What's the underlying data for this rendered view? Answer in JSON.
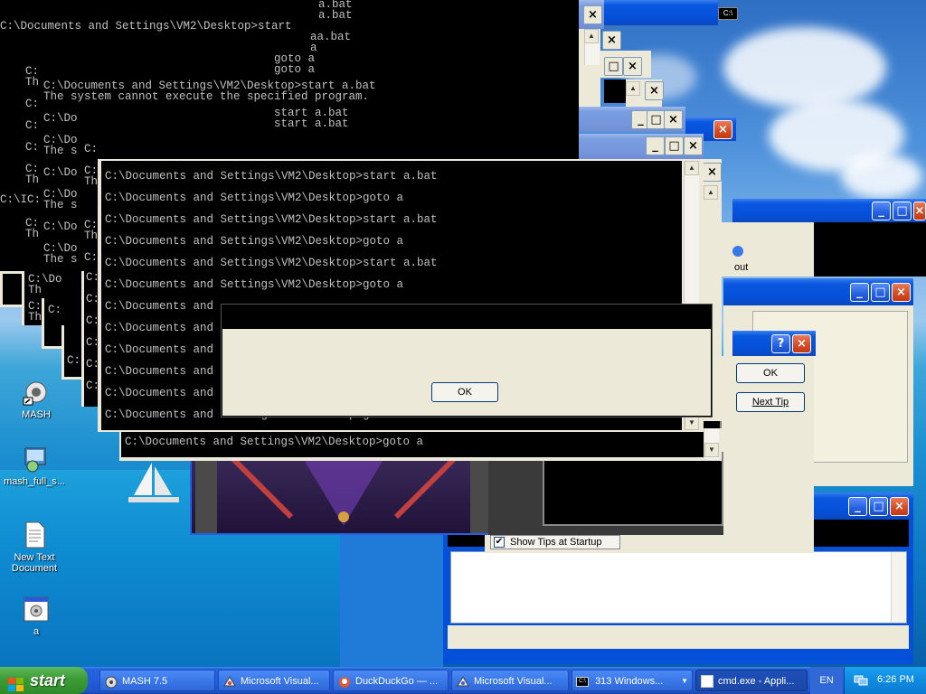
{
  "console_main": {
    "top_lines": [
      "a.bat",
      "a.bat"
    ],
    "line1": "C:\\Documents and Settings\\VM2\\Desktop>start",
    "col_lines": [
      "aa.bat",
      "a",
      "goto a",
      "goto a"
    ],
    "stack_lines": [
      "start a.bat",
      "start a.bat"
    ],
    "c_prompt": "C:",
    "cmd_start": "C:\\Documents and Settings\\VM2\\Desktop>start a.bat",
    "error": "The system cannot execute the specified program.",
    "frag_th": "Th",
    "frag_cdo": "C:\\Do",
    "frag_thes": "The s",
    "frag_c": "C:",
    "frag_cic": "C:\\IC:"
  },
  "console_front": {
    "lines": [
      "C:\\Documents and Settings\\VM2\\Desktop>start a.bat",
      "C:\\Documents and Settings\\VM2\\Desktop>goto a",
      "C:\\Documents and Settings\\VM2\\Desktop>start a.bat",
      "C:\\Documents and Settings\\VM2\\Desktop>goto a",
      "C:\\Documents and Settings\\VM2\\Desktop>start a.bat",
      "C:\\Documents and Settings\\VM2\\Desktop>goto a"
    ],
    "trunc": "C:\\Documents and",
    "last_line": "C:\\Documents and Settings\\VM2\\Desktop>goto a",
    "bottom_line": "C:\\Documents and Settings\\VM2\\Desktop>goto a"
  },
  "dialog": {
    "ok": "OK"
  },
  "tips_dialog": {
    "help": "?",
    "close": "×",
    "ok": "OK",
    "next": "Next Tip",
    "show_tips": "Show Tips at Startup"
  },
  "partial_window": {
    "about": "out"
  },
  "controls": {
    "close": "×",
    "min": "_",
    "max": "□",
    "restore": "⧉"
  },
  "desktop_icons": [
    {
      "label": "MASH"
    },
    {
      "label": "mash_full_s..."
    },
    {
      "label": "New Text Document"
    },
    {
      "label": "a"
    }
  ],
  "taskbar": {
    "start": "start",
    "tasks": [
      "MASH 7.5",
      "Microsoft Visual...",
      "DuckDuckGo — ...",
      "Microsoft Visual...",
      "313 Windows...",
      "cmd.exe - Appli..."
    ],
    "lang": "EN",
    "clock": "6:26 PM"
  },
  "colors": {
    "xp_blue": "#0550d8",
    "start_green": "#3c9b36",
    "console_bg": "#000000",
    "close_red": "#d44a23"
  }
}
